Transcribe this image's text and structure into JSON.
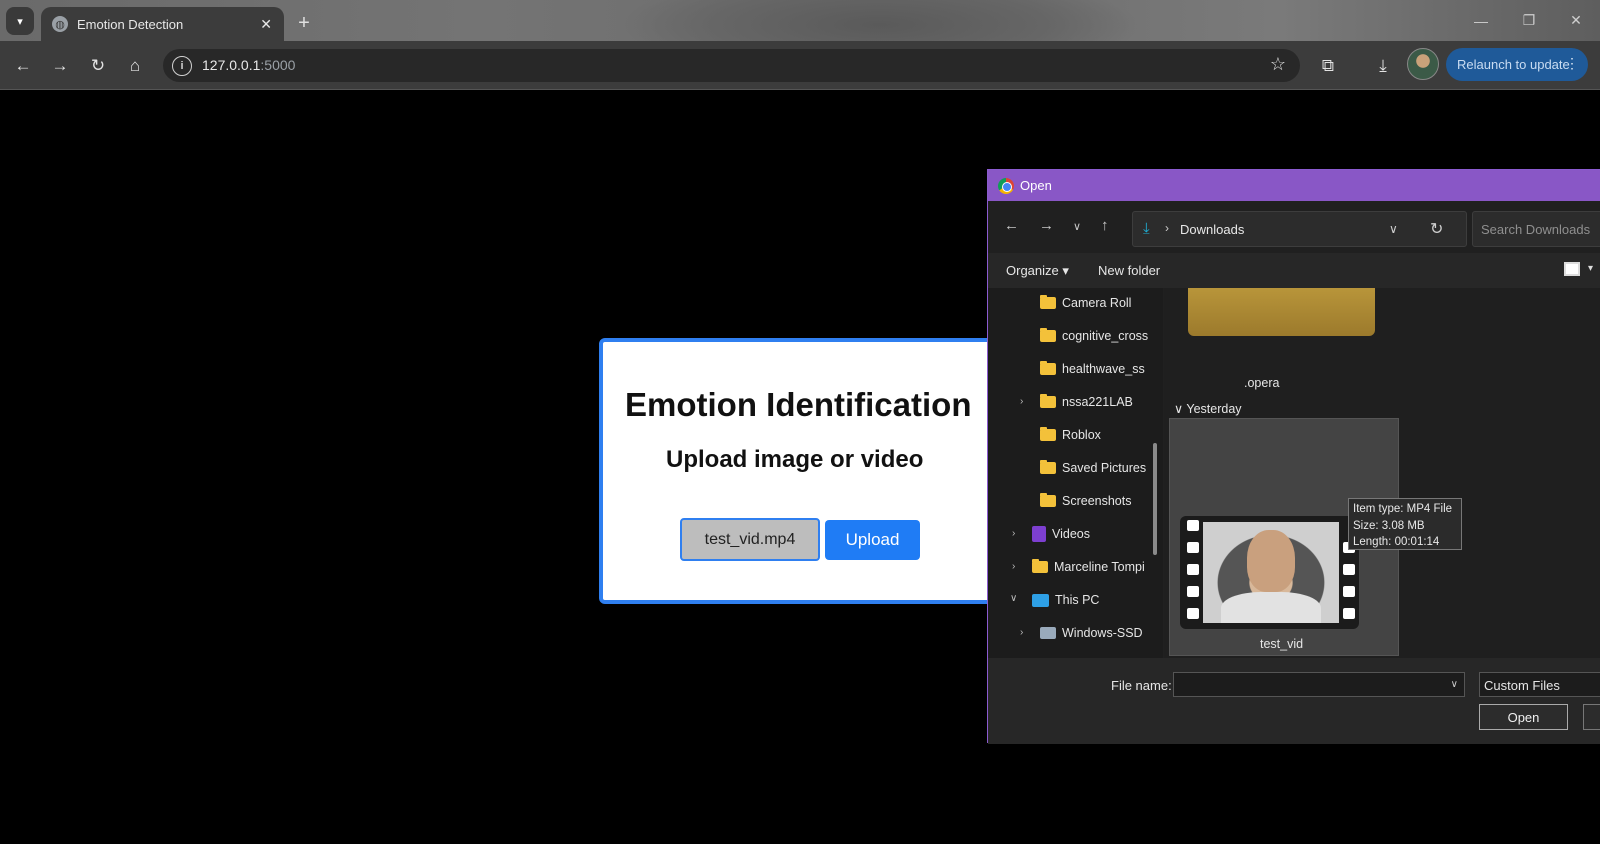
{
  "browser": {
    "tab_title": "Emotion Detection",
    "tab_close": "✕",
    "new_tab": "+",
    "url_host": "127.0.0.1",
    "url_port": ":5000",
    "relaunch_label": "Relaunch to update"
  },
  "page": {
    "title": "Emotion Identification",
    "subtitle": "Upload image or video",
    "file_button_label": "test_vid.mp4",
    "upload_button_label": "Upload"
  },
  "dialog": {
    "title": "Open",
    "location": "Downloads",
    "search_placeholder": "Search Downloads",
    "organize_label": "Organize ▾",
    "new_folder_label": "New folder",
    "nav_items": [
      {
        "label": "Camera Roll"
      },
      {
        "label": "cognitive_cross"
      },
      {
        "label": "healthwave_ss"
      },
      {
        "label": "nssa221LAB"
      },
      {
        "label": "Roblox"
      },
      {
        "label": "Saved Pictures"
      },
      {
        "label": "Screenshots"
      },
      {
        "label": "Videos"
      },
      {
        "label": "Marceline Tompi"
      },
      {
        "label": "This PC"
      },
      {
        "label": "Windows-SSD"
      }
    ],
    "items": {
      "opera_label": ".opera",
      "group_yesterday": "Yesterday",
      "video_label": "test_vid"
    },
    "tooltip": {
      "type": "Item type: MP4 File",
      "size": "Size: 3.08 MB",
      "length": "Length: 00:01:14"
    },
    "footer": {
      "file_name_label": "File name:",
      "file_name_value": "",
      "file_type": "Custom Files",
      "open_label": "Open"
    }
  }
}
